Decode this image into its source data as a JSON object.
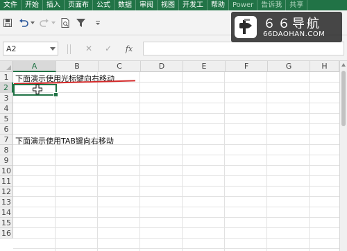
{
  "ribbon": {
    "tabs": [
      "文件",
      "开始",
      "插入",
      "页面布",
      "公式",
      "数据",
      "审阅",
      "视图",
      "开发工",
      "帮助",
      "Power",
      "告诉我",
      "共享"
    ]
  },
  "name_box": {
    "value": "A2"
  },
  "formula_bar": {
    "cancel": "✕",
    "enter": "✓",
    "fx": "fx",
    "value": ""
  },
  "sheet": {
    "columns": [
      "A",
      "B",
      "C",
      "D",
      "E",
      "F",
      "G",
      "H"
    ],
    "rows": [
      "1",
      "2",
      "3",
      "4",
      "5",
      "6",
      "7",
      "8",
      "9",
      "10",
      "11",
      "12",
      "13",
      "14",
      "15",
      "16"
    ],
    "active_cell": "A2",
    "cells": {
      "A1": "下面演示使用光标键向右移动",
      "A7": "下面演示使用TAB键向右移动"
    }
  },
  "watermark": {
    "title": "６６导航",
    "subtitle": "66DAOHAN.COM"
  },
  "colors": {
    "ribbon": "#217346",
    "selection": "#217346",
    "annotation_line": "#d42a2a"
  }
}
